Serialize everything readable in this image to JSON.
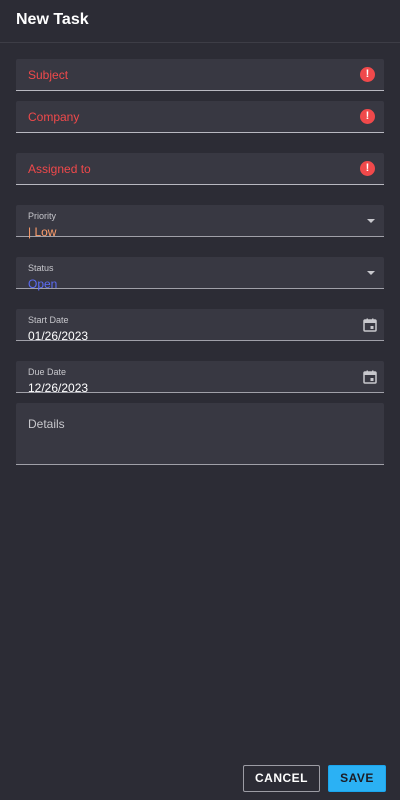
{
  "header": {
    "title": "New Task"
  },
  "form": {
    "subject": {
      "placeholder": "Subject"
    },
    "company": {
      "placeholder": "Company"
    },
    "assigned": {
      "placeholder": "Assigned to"
    },
    "priority": {
      "label": "Priority",
      "value": "| Low"
    },
    "status": {
      "label": "Status",
      "value": "Open"
    },
    "start_date": {
      "label": "Start Date",
      "value": "01/26/2023"
    },
    "due_date": {
      "label": "Due Date",
      "value": "12/26/2023"
    },
    "details": {
      "placeholder": "Details"
    }
  },
  "icons": {
    "error": "exclamation-circle-icon",
    "dropdown": "caret-down-icon",
    "calendar": "calendar-icon"
  },
  "colors": {
    "background": "#2c2c35",
    "field": "#383842",
    "error": "#f0494b",
    "priority": "#ff9d6a",
    "status": "#5b6cf5",
    "accent": "#2bb1f4"
  },
  "footer": {
    "cancel_label": "CANCEL",
    "save_label": "SAVE"
  }
}
